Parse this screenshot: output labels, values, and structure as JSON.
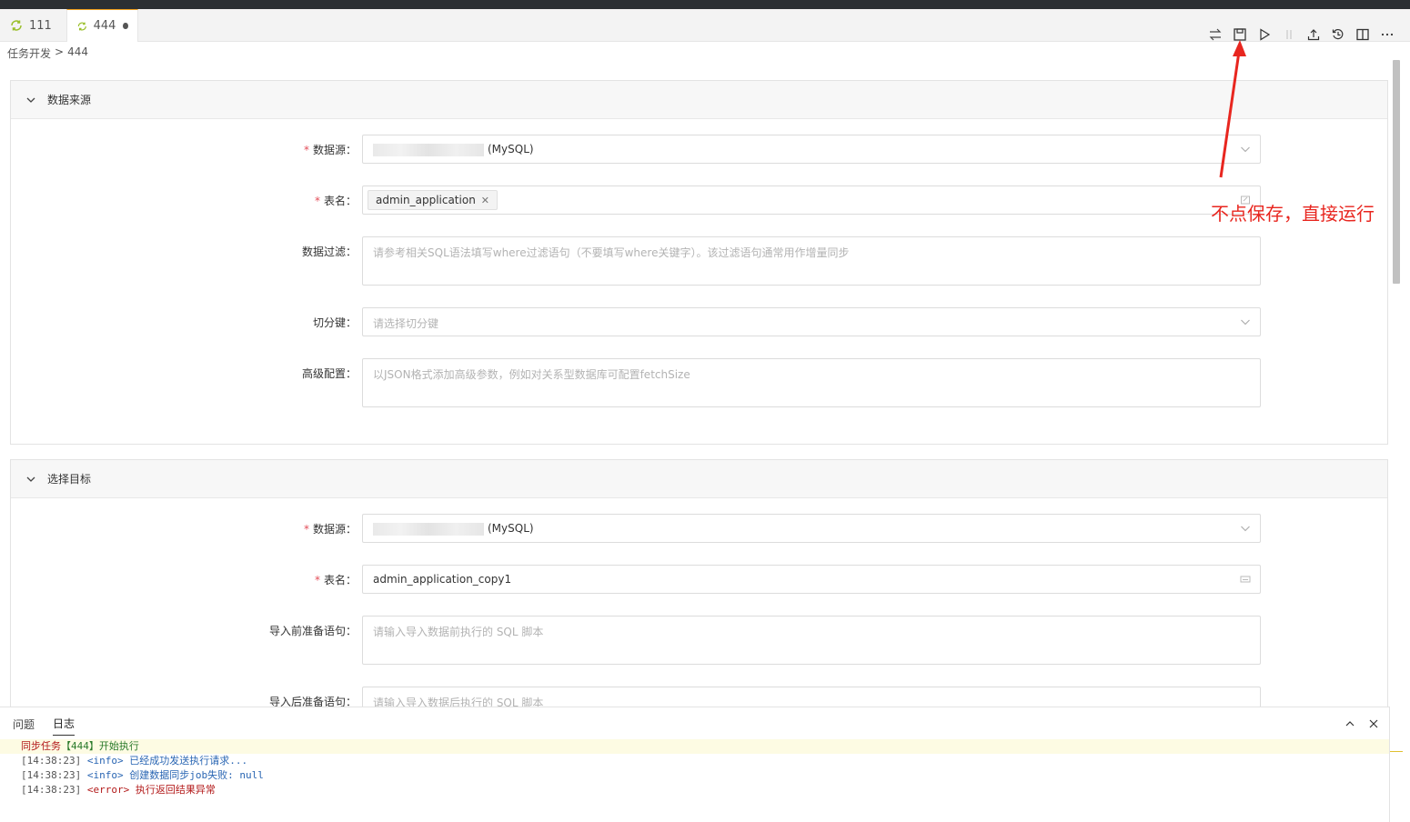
{
  "tabs": [
    {
      "label": "111"
    },
    {
      "label": "444"
    }
  ],
  "breadcrumb": {
    "root": "任务开发",
    "separator": ">",
    "current": "444"
  },
  "source_panel": {
    "title": "数据来源",
    "datasource_label": "数据源",
    "datasource_value": "(MySQL)",
    "table_label": "表名",
    "table_tag": "admin_application",
    "filter_label": "数据过滤",
    "filter_placeholder": "请参考相关SQL语法填写where过滤语句（不要填写where关键字）。该过滤语句通常用作增量同步",
    "split_label": "切分键",
    "split_placeholder": "请选择切分键",
    "advanced_label": "高级配置",
    "advanced_placeholder": "以JSON格式添加高级参数，例如对关系型数据库可配置fetchSize"
  },
  "target_panel": {
    "title": "选择目标",
    "datasource_label": "数据源",
    "datasource_value": "(MySQL)",
    "table_label": "表名",
    "table_value": "admin_application_copy1",
    "pre_sql_label": "导入前准备语句",
    "pre_sql_placeholder": "请输入导入数据前执行的 SQL 脚本",
    "post_sql_label": "导入后准备语句",
    "post_sql_placeholder": "请输入导入数据后执行的 SQL 脚本"
  },
  "bottom_panel": {
    "tabs": [
      {
        "label": "问题"
      },
      {
        "label": "日志"
      }
    ],
    "logs": [
      {
        "prefix": "同步任务",
        "task": "【444】",
        "msg": "开始执行"
      },
      {
        "time": "[14:38:23]",
        "level": "<info>",
        "msg": "已经成功发送执行请求..."
      },
      {
        "time": "[14:38:23]",
        "level": "<info>",
        "msg": "创建数据同步job失败: null"
      },
      {
        "time": "[14:38:23]",
        "level": "<error>",
        "msg": "执行返回结果异常"
      }
    ]
  },
  "annotation": {
    "text": "不点保存，直接运行"
  },
  "colors": {
    "accent": "#f0a020",
    "annotation": "#e8261f",
    "required": "#e34d59",
    "error": "#b31b1b",
    "info": "#2a66b3"
  },
  "icons": [
    "sync-icon",
    "swap-icon",
    "save-icon",
    "run-icon",
    "pause-icon",
    "upload-icon",
    "history-icon",
    "split-view-icon",
    "more-icon",
    "chevron-down-icon",
    "chevron-up-icon",
    "close-icon"
  ]
}
